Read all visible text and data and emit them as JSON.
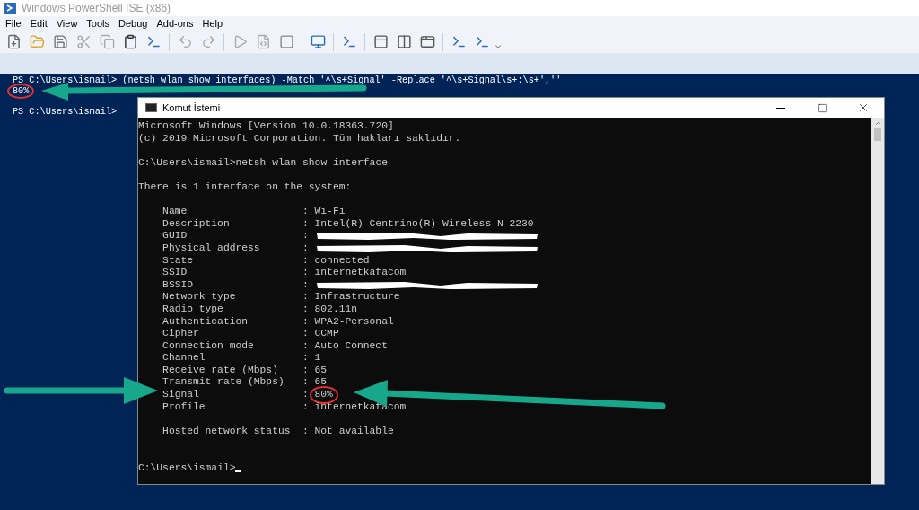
{
  "window": {
    "title": "Windows PowerShell ISE (x86)"
  },
  "menu": [
    "File",
    "Edit",
    "View",
    "Tools",
    "Debug",
    "Add-ons",
    "Help"
  ],
  "ps_console": {
    "lines": [
      {
        "text": "PS C:\\Users\\ismail> (netsh wlan show interfaces) -Match '^\\s+Signal' -Replace '^\\s+Signal\\s+:\\s+',''",
        "circled": false
      },
      {
        "text": "80%",
        "circled": true
      },
      {
        "text": "PS C:\\Users\\ismail>",
        "circled": false
      }
    ]
  },
  "cmd_window": {
    "title": "Komut İstemi",
    "separator": ":",
    "lines": [
      {
        "kind": "text",
        "text": "Microsoft Windows [Version 10.0.18363.720]"
      },
      {
        "kind": "text",
        "text": "(c) 2019 Microsoft Corporation. Tüm hakları saklıdır."
      },
      {
        "kind": "blank"
      },
      {
        "kind": "text",
        "text": "C:\\Users\\ismail>netsh wlan show interface"
      },
      {
        "kind": "blank"
      },
      {
        "kind": "text",
        "text": "There is 1 interface on the system:"
      },
      {
        "kind": "blank"
      },
      {
        "kind": "property",
        "label": "Name",
        "value": "Wi-Fi",
        "circled": false
      },
      {
        "kind": "property",
        "label": "Description",
        "value": "Intel(R) Centrino(R) Wireless-N 2230",
        "circled": false
      },
      {
        "kind": "redacted",
        "label": "GUID"
      },
      {
        "kind": "redacted",
        "label": "Physical address"
      },
      {
        "kind": "property",
        "label": "State",
        "value": "connected",
        "circled": false
      },
      {
        "kind": "property",
        "label": "SSID",
        "value": "internetkafacom",
        "circled": false
      },
      {
        "kind": "redacted",
        "label": "BSSID"
      },
      {
        "kind": "property",
        "label": "Network type",
        "value": "Infrastructure",
        "circled": false
      },
      {
        "kind": "property",
        "label": "Radio type",
        "value": "802.11n",
        "circled": false
      },
      {
        "kind": "property",
        "label": "Authentication",
        "value": "WPA2-Personal",
        "circled": false
      },
      {
        "kind": "property",
        "label": "Cipher",
        "value": "CCMP",
        "circled": false
      },
      {
        "kind": "property",
        "label": "Connection mode",
        "value": "Auto Connect",
        "circled": false
      },
      {
        "kind": "property",
        "label": "Channel",
        "value": "1",
        "circled": false
      },
      {
        "kind": "property",
        "label": "Receive rate (Mbps)",
        "value": "65",
        "circled": false
      },
      {
        "kind": "property",
        "label": "Transmit rate (Mbps)",
        "value": "65",
        "circled": false
      },
      {
        "kind": "property",
        "label": "Signal",
        "value": "80%",
        "circled": true
      },
      {
        "kind": "property",
        "label": "Profile",
        "value": "internetkafacom",
        "circled": false
      },
      {
        "kind": "blank"
      },
      {
        "kind": "property",
        "label": "Hosted network status",
        "value": "Not available",
        "circled": false
      },
      {
        "kind": "blank"
      },
      {
        "kind": "blank"
      },
      {
        "kind": "prompt",
        "text": "C:\\Users\\ismail>"
      }
    ]
  }
}
